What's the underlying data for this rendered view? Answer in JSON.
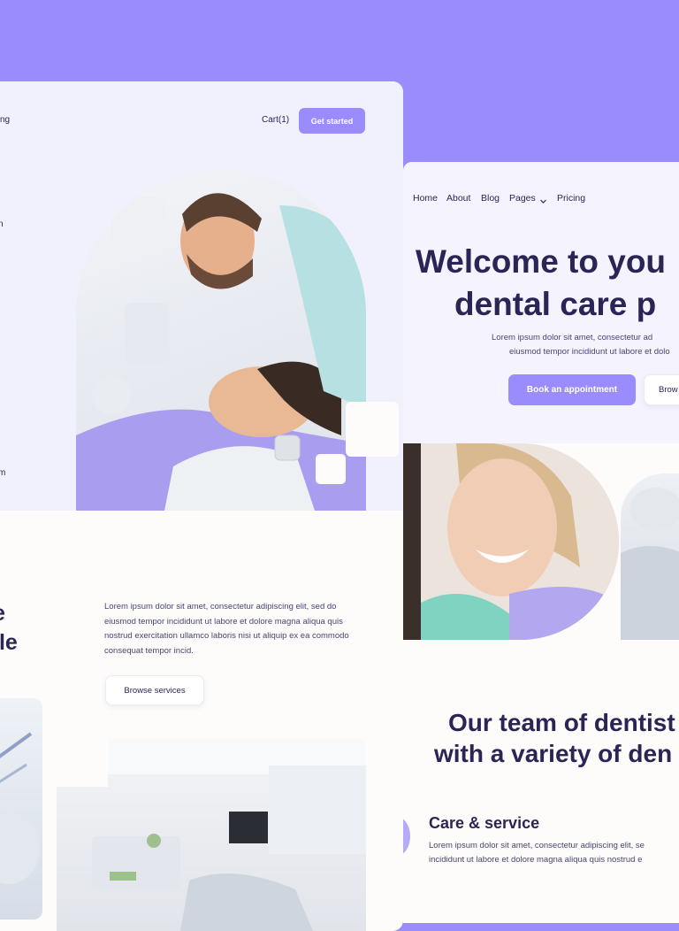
{
  "left": {
    "nav": {
      "pricing_fragment": "ng",
      "cart_label": "Cart(1)",
      "cta_label": "Get started"
    },
    "hero": {
      "side_fragment_1": "n",
      "side_fragment_2": "m"
    },
    "section": {
      "title_fragment_line1": "e",
      "title_fragment_line2": "ile",
      "paragraph": "Lorem ipsum dolor sit amet, consectetur adipiscing elit, sed do eiusmod tempor incididunt ut labore et dolore magna aliqua quis nostrud exercitation ullamco laboris nisi ut aliquip ex ea commodo consequat tempor incid.",
      "browse_label": "Browse services"
    }
  },
  "right": {
    "nav": {
      "items": [
        "Home",
        "About",
        "Blog",
        "Pages",
        "Pricing"
      ]
    },
    "hero": {
      "headline_line1": "Welcome to you",
      "headline_line2": "dental care p",
      "subtext_line1": "Lorem ipsum dolor sit amet, consectetur ad",
      "subtext_line2": "eiusmod tempor incididunt ut labore et dolo",
      "primary_label": "Book an appointment",
      "secondary_label": "Brow"
    },
    "team": {
      "headline_line1": "Our team of dentist",
      "headline_line2": "with a variety of den"
    },
    "service": {
      "title": "Care & service",
      "text_line1": "Lorem ipsum dolor sit amet, consectetur adipiscing elit, se",
      "text_line2": "incididunt ut labore et dolore magna aliqua quis nostrud e"
    }
  },
  "colors": {
    "accent": "#9a8cfc",
    "ink": "#2b2556",
    "soft_bg": "#f1f0fd"
  }
}
